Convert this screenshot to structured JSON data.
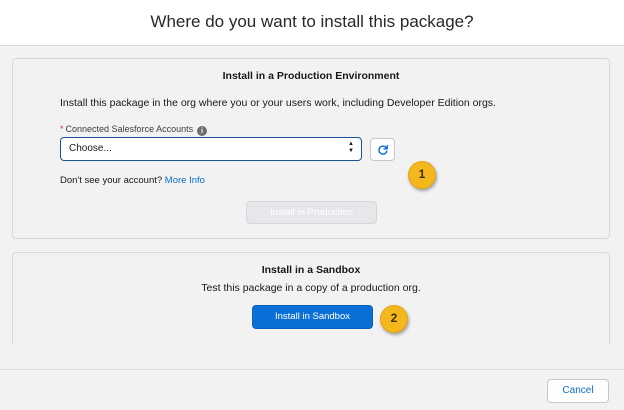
{
  "dialog": {
    "title": "Where do you want to install this package?"
  },
  "production": {
    "title": "Install in a Production Environment",
    "description": "Install this package in the org where you or your users work, including Developer Edition orgs.",
    "field_required_mark": "*",
    "field_label": "Connected Salesforce Accounts",
    "info_icon": "info-icon",
    "select_value": "Choose...",
    "refresh_icon": "refresh-icon",
    "account_prompt": "Don't see your account?",
    "more_info_link": "More Info",
    "install_button": "Install in Production",
    "install_button_enabled": false
  },
  "sandbox": {
    "title": "Install in a Sandbox",
    "description": "Test this package in a copy of a production org.",
    "install_button": "Install in Sandbox"
  },
  "annotations": {
    "badge_1": "1",
    "badge_2": "2",
    "badge_color": "#f5b81c"
  },
  "footer": {
    "cancel_button": "Cancel"
  },
  "colors": {
    "accent": "#0a70d8",
    "link": "#0a6ed1",
    "required": "#c23934"
  }
}
